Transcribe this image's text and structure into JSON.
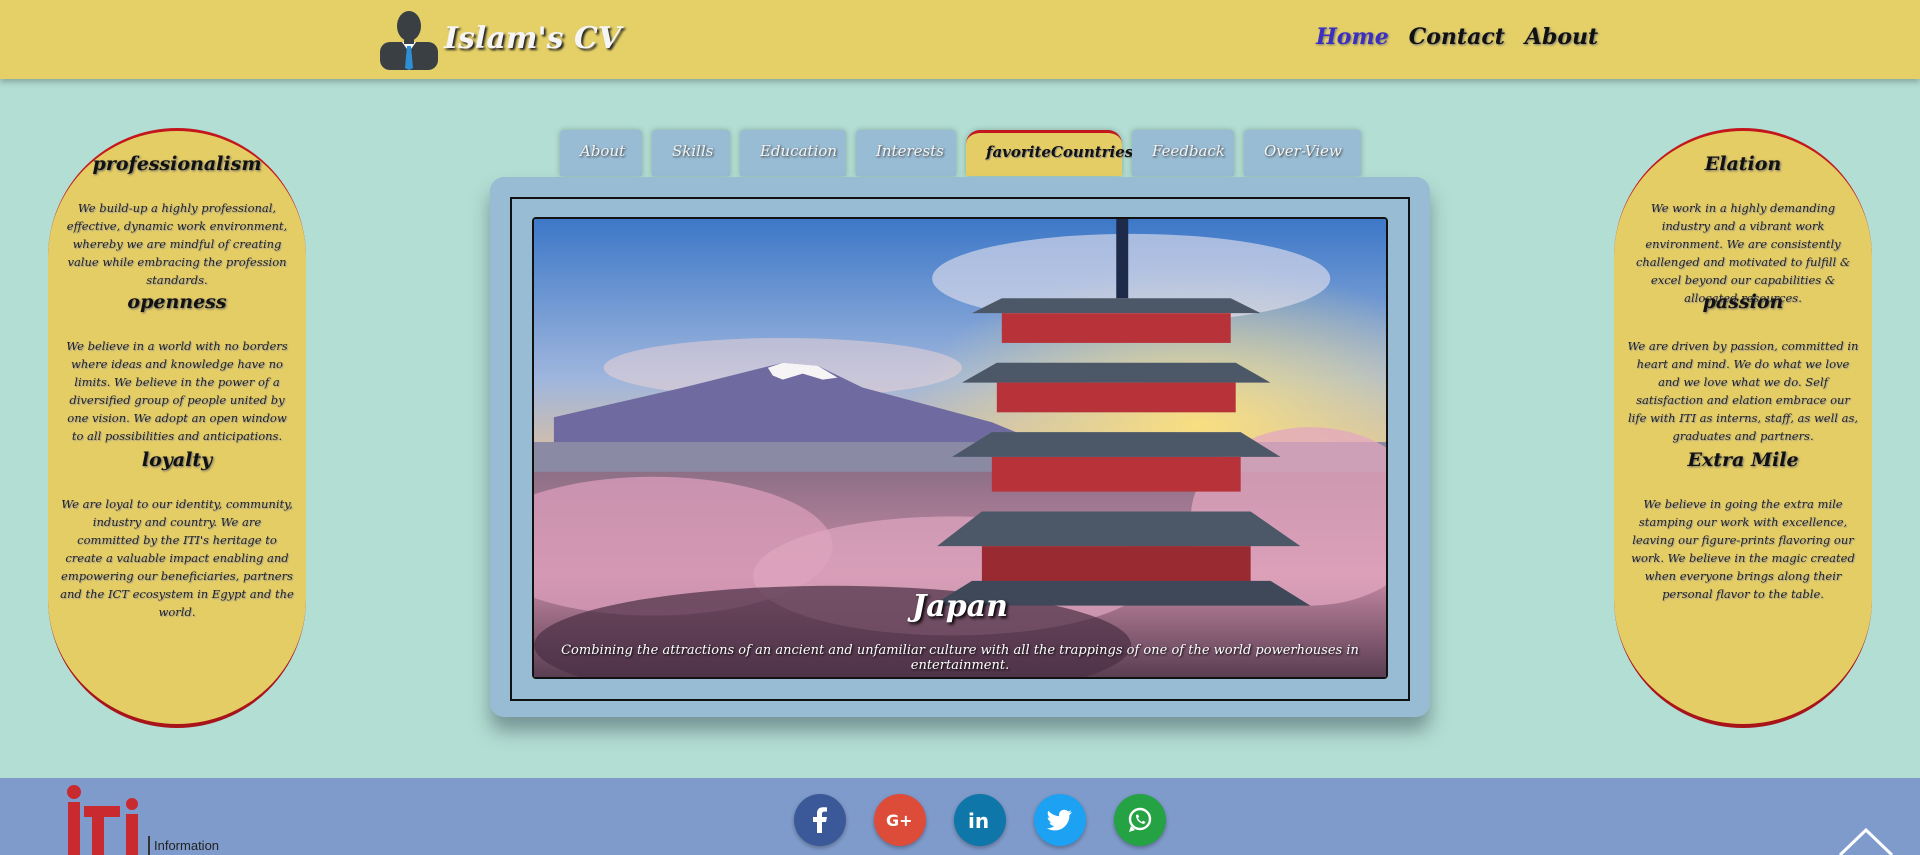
{
  "header": {
    "brand_title": "Islam's CV",
    "nav": [
      {
        "label": "Home",
        "active": true
      },
      {
        "label": "Contact",
        "active": false
      },
      {
        "label": "About",
        "active": false
      }
    ]
  },
  "left_column": [
    {
      "title": "professionalism",
      "text": "We build-up a highly professional, effective, dynamic work environment, whereby we are mindful of creating value while embracing the profession standards."
    },
    {
      "title": "openness",
      "text": "We believe in a world with no borders where ideas and knowledge have no limits. We believe in the power of a diversified group of people united by one vision. We adopt an open window to all possibilities and anticipations."
    },
    {
      "title": "loyalty",
      "text": "We are loyal to our identity, community, industry and country. We are committed by the ITI's heritage to create a valuable impact enabling and empowering our beneficiaries, partners and the ICT ecosystem in Egypt and the world."
    }
  ],
  "right_column": [
    {
      "title": "Elation",
      "text": "We work in a highly demanding industry and a vibrant work environment. We are consistently challenged and motivated to fulfill & excel beyond our capabilities & allocated resources."
    },
    {
      "title": "passion",
      "text": "We are driven by passion, committed in heart and mind. We do what we love and we love what we do. Self satisfaction and elation embrace our life with ITI as interns, staff, as well as, graduates and partners."
    },
    {
      "title": "Extra Mile",
      "text": "We believe in going the extra mile stamping our work with excellence, leaving our figure-prints flavoring our work. We believe in the magic created when everyone brings along their personal flavor to the table."
    }
  ],
  "tabs": [
    {
      "label": "About",
      "active": false
    },
    {
      "label": "Skills",
      "active": false
    },
    {
      "label": "Education",
      "active": false
    },
    {
      "label": "Interests",
      "active": false
    },
    {
      "label": "favoriteCountries",
      "active": true
    },
    {
      "label": "Feedback",
      "active": false
    },
    {
      "label": "Over-View",
      "active": false
    }
  ],
  "slide": {
    "title": "Japan",
    "text": "Combining the attractions of an ancient and unfamiliar culture with all the trappings of one of the world powerhouses in entertainment."
  },
  "footer": {
    "logo_text": "Information",
    "socials": [
      {
        "icon": "facebook-icon",
        "color": "#3b5998"
      },
      {
        "icon": "google-plus-icon",
        "color": "#dd4b39"
      },
      {
        "icon": "linkedin-icon",
        "color": "#0e76a8"
      },
      {
        "icon": "twitter-icon",
        "color": "#1da1f2"
      },
      {
        "icon": "whatsapp-icon",
        "color": "#25a244"
      }
    ]
  },
  "colors": {
    "background": "#b3ded3",
    "header": "#e5d067",
    "pill": "#e5cd65",
    "pill_border": "#a8141a",
    "panel": "#98bcd4",
    "footer": "#7f9bcb",
    "nav_active": "#3b2fc0"
  }
}
